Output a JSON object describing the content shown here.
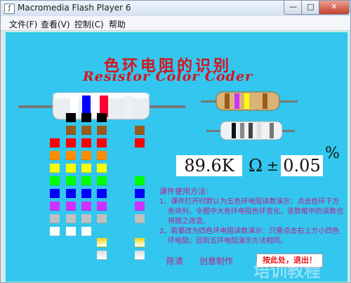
{
  "window": {
    "title": "Macromedia Flash Player 6"
  },
  "window_buttons": {
    "minimize": "—",
    "maximize": "□",
    "close": "✕"
  },
  "menu": {
    "items": [
      "文件(F)",
      "查看(V)",
      "控制(C)",
      "帮助"
    ]
  },
  "title": {
    "chinese": "色环电阻的识别",
    "english": "Resistor Color Coder"
  },
  "display": {
    "value": "89.6K",
    "ohm": "Ω",
    "plus_minus": "±",
    "tolerance": "0.05",
    "percent": "%"
  },
  "help": {
    "heading": "课件使用方法:",
    "item1": "1、课件打开时默认为五色环电阻读数演示：点击色环下方色块列，令图中大色环电阻色环变化，该数框中的读数也将随之改变。",
    "item2": "2、若要改为四色环电阻读数演示：只需点击右上方小四色环电阻；回到五环电阻演示方法相同。"
  },
  "footer": {
    "author_label": "陈清",
    "production": "创意制作",
    "button": "按此处，退出！"
  },
  "watermark": "培训教程",
  "colors": {
    "black": "#000000",
    "brown": "#9b5a1a",
    "red": "#ff0000",
    "orange": "#ff8c00",
    "yellow": "#ffff00",
    "green": "#00ff00",
    "blue": "#0000ff",
    "violet": "#cc33ff",
    "gray": "#c0c0c0",
    "white": "#ffffff",
    "gold": "#ffd200",
    "silver": "#dddddd"
  }
}
